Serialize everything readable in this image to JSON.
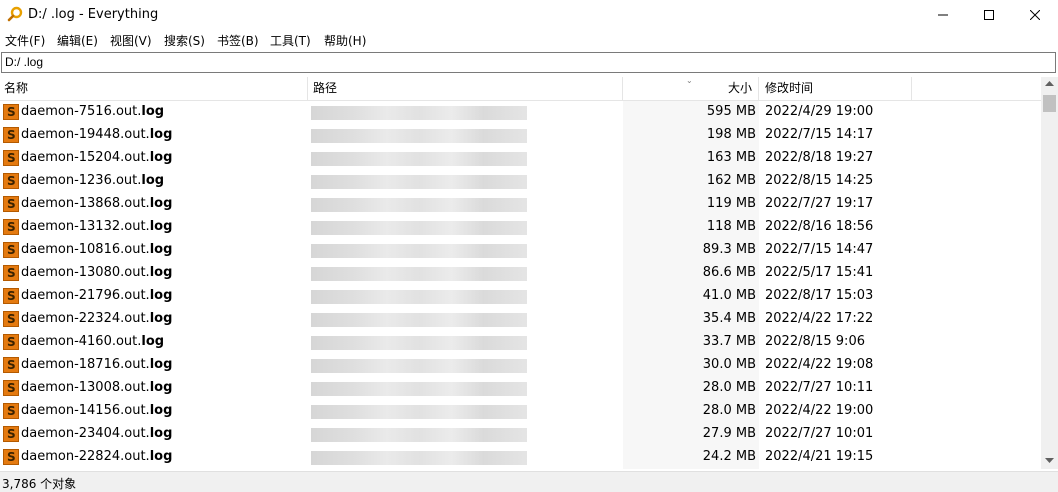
{
  "window": {
    "title": "D:/ .log - Everything"
  },
  "menu": [
    "文件(F)",
    "编辑(E)",
    "视图(V)",
    "搜索(S)",
    "书签(B)",
    "工具(T)",
    "帮助(H)"
  ],
  "search": {
    "value": "D:/ .log"
  },
  "columns": {
    "name": "名称",
    "path": "路径",
    "size": "大小",
    "modified": "修改时间"
  },
  "files": [
    {
      "base": "daemon-7516.out.",
      "ext": "log",
      "size": "595 MB",
      "modified": "2022/4/29 19:00"
    },
    {
      "base": "daemon-19448.out.",
      "ext": "log",
      "size": "198 MB",
      "modified": "2022/7/15 14:17"
    },
    {
      "base": "daemon-15204.out.",
      "ext": "log",
      "size": "163 MB",
      "modified": "2022/8/18 19:27"
    },
    {
      "base": "daemon-1236.out.",
      "ext": "log",
      "size": "162 MB",
      "modified": "2022/8/15 14:25"
    },
    {
      "base": "daemon-13868.out.",
      "ext": "log",
      "size": "119 MB",
      "modified": "2022/7/27 19:17"
    },
    {
      "base": "daemon-13132.out.",
      "ext": "log",
      "size": "118 MB",
      "modified": "2022/8/16 18:56"
    },
    {
      "base": "daemon-10816.out.",
      "ext": "log",
      "size": "89.3 MB",
      "modified": "2022/7/15 14:47"
    },
    {
      "base": "daemon-13080.out.",
      "ext": "log",
      "size": "86.6 MB",
      "modified": "2022/5/17 15:41"
    },
    {
      "base": "daemon-21796.out.",
      "ext": "log",
      "size": "41.0 MB",
      "modified": "2022/8/17 15:03"
    },
    {
      "base": "daemon-22324.out.",
      "ext": "log",
      "size": "35.4 MB",
      "modified": "2022/4/22 17:22"
    },
    {
      "base": "daemon-4160.out.",
      "ext": "log",
      "size": "33.7 MB",
      "modified": "2022/8/15 9:06"
    },
    {
      "base": "daemon-18716.out.",
      "ext": "log",
      "size": "30.0 MB",
      "modified": "2022/4/22 19:08"
    },
    {
      "base": "daemon-13008.out.",
      "ext": "log",
      "size": "28.0 MB",
      "modified": "2022/7/27 10:11"
    },
    {
      "base": "daemon-14156.out.",
      "ext": "log",
      "size": "28.0 MB",
      "modified": "2022/4/22 19:00"
    },
    {
      "base": "daemon-23404.out.",
      "ext": "log",
      "size": "27.9 MB",
      "modified": "2022/7/27 10:01"
    },
    {
      "base": "daemon-22824.out.",
      "ext": "log",
      "size": "24.2 MB",
      "modified": "2022/4/21 19:15"
    }
  ],
  "status": {
    "text": "3,786 个对象"
  },
  "icons": {
    "app": "magnifier-icon",
    "file": "sublime-file-icon"
  },
  "colors": {
    "file_icon": "#e47a10",
    "app_icon": "#e8a000"
  }
}
